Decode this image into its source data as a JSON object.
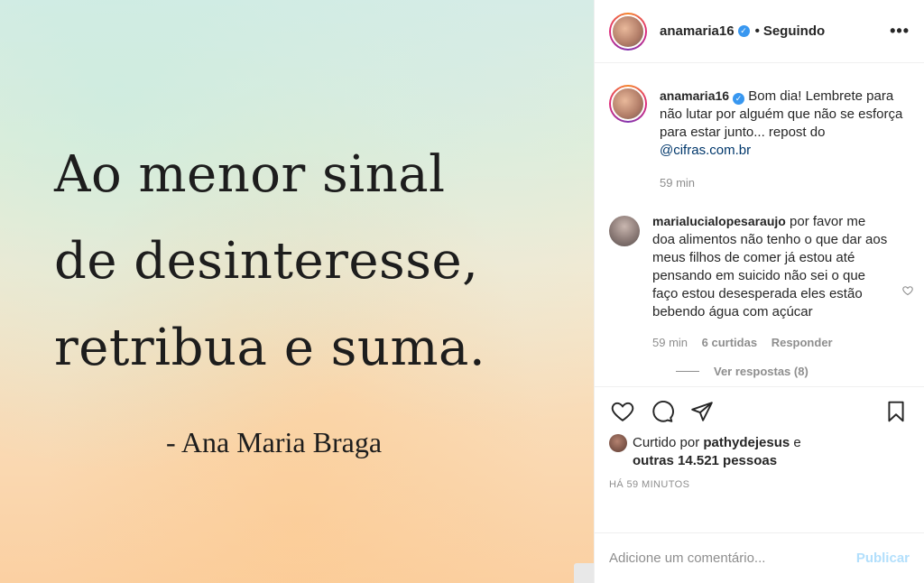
{
  "post_image": {
    "quote_lines": [
      "Ao menor sinal",
      "de desinteresse,",
      "retribua e suma."
    ],
    "author": "- Ana Maria Braga"
  },
  "header": {
    "username": "anamaria16",
    "separator": "•",
    "follow_status": "Seguindo",
    "more": "•••"
  },
  "caption": {
    "username": "anamaria16",
    "text": "Bom dia! Lembrete para não lutar por alguém que não se esforça para estar junto... repost do ",
    "mention": "@cifras.com.br",
    "time": "59 min"
  },
  "comment": {
    "username": "marialucialopesaraujo",
    "text": "por favor me doa alimentos não tenho o que dar aos meus filhos de comer já estou até pensando em suicido não sei o que faço estou desesperada eles estão bebendo água com açúcar",
    "time": "59 min",
    "likes": "6 curtidas",
    "reply": "Responder",
    "view_replies": "Ver respostas (8)"
  },
  "likes": {
    "prefix": "Curtido por ",
    "user": "pathydejesus",
    "middle": " e",
    "others": "outras 14.521 pessoas"
  },
  "timestamp": "HÁ 59 MINUTOS",
  "add_comment": {
    "placeholder": "Adicione um comentário...",
    "publish": "Publicar"
  },
  "colors": {
    "link": "#00376b",
    "muted": "#8e8e8e",
    "verified": "#3897f0",
    "publish_disabled": "#b2dffc"
  }
}
